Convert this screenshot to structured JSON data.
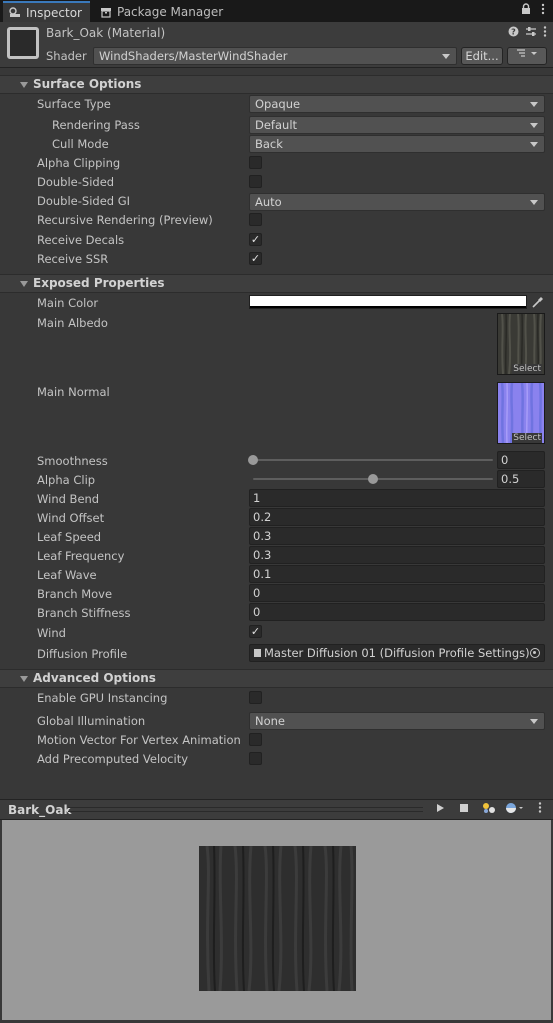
{
  "tabs": [
    {
      "label": "Inspector",
      "icon": "inspector-icon",
      "active": true
    },
    {
      "label": "Package Manager",
      "icon": "package-icon",
      "active": false
    }
  ],
  "tab_tools": [
    "lock-icon",
    "kebab-menu-icon"
  ],
  "header": {
    "material_name": "Bark_Oak (Material)",
    "shader_label": "Shader",
    "shader_value": "WindShaders/MasterWindShader",
    "edit_label": "Edit...",
    "tools": [
      "help-icon",
      "preset-icon",
      "kebab-menu-icon"
    ]
  },
  "surface_options": {
    "title": "Surface Options",
    "surface_type": {
      "label": "Surface Type",
      "value": "Opaque"
    },
    "rendering_pass": {
      "label": "Rendering Pass",
      "value": "Default"
    },
    "cull_mode": {
      "label": "Cull Mode",
      "value": "Back"
    },
    "alpha_clipping": {
      "label": "Alpha Clipping",
      "checked": false
    },
    "double_sided": {
      "label": "Double-Sided",
      "checked": false
    },
    "double_sided_gi": {
      "label": "Double-Sided GI",
      "value": "Auto"
    },
    "recursive_rendering": {
      "label": "Recursive Rendering (Preview)",
      "checked": false
    },
    "receive_decals": {
      "label": "Receive Decals",
      "checked": true,
      "mark": "✓"
    },
    "receive_ssr": {
      "label": "Receive SSR",
      "checked": true,
      "mark": "✓"
    }
  },
  "exposed_properties": {
    "title": "Exposed Properties",
    "main_color": {
      "label": "Main Color",
      "color": "#ffffff"
    },
    "main_albedo": {
      "label": "Main Albedo",
      "select": "Select"
    },
    "main_normal": {
      "label": "Main Normal",
      "select": "Select"
    },
    "smoothness": {
      "label": "Smoothness",
      "value": "0",
      "fraction": 0
    },
    "alpha_clip": {
      "label": "Alpha Clip",
      "value": "0.5",
      "fraction": 0.5
    },
    "wind_bend": {
      "label": "Wind Bend",
      "value": "1"
    },
    "wind_offset": {
      "label": "Wind Offset",
      "value": "0.2"
    },
    "leaf_speed": {
      "label": "Leaf Speed",
      "value": "0.3"
    },
    "leaf_frequency": {
      "label": "Leaf Frequency",
      "value": "0.3"
    },
    "leaf_wave": {
      "label": "Leaf Wave",
      "value": "0.1"
    },
    "branch_move": {
      "label": "Branch Move",
      "value": "0"
    },
    "branch_stiffness": {
      "label": "Branch Stiffness",
      "value": "0"
    },
    "wind": {
      "label": "Wind",
      "checked": true,
      "mark": "✓"
    },
    "diffusion_profile": {
      "label": "Diffusion Profile",
      "value": "Master Diffusion 01 (Diffusion Profile Settings)"
    }
  },
  "advanced_options": {
    "title": "Advanced Options",
    "gpu_instancing": {
      "label": "Enable GPU Instancing",
      "checked": false
    },
    "global_illumination": {
      "label": "Global Illumination",
      "value": "None"
    },
    "motion_vector": {
      "label": "Motion Vector For Vertex Animation",
      "checked": false
    },
    "precomputed_velocity": {
      "label": "Add Precomputed Velocity",
      "checked": false
    }
  },
  "preview": {
    "title": "Bark_Oak",
    "tools": [
      "play-icon",
      "stop-icon",
      "lighting-icon",
      "sphere-icon",
      "kebab-menu-icon"
    ]
  },
  "colors": {
    "accent": "#3a79bb",
    "preview_bg": "#9a9a9a",
    "normal_map": "#8f86f4"
  }
}
